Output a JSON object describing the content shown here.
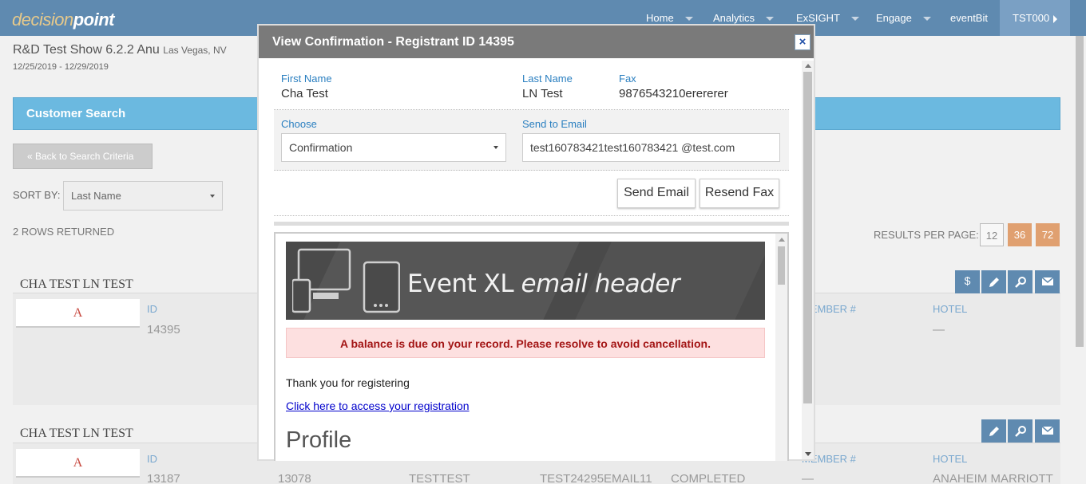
{
  "brand": {
    "logo_part1": "decision",
    "logo_part2": "point"
  },
  "nav": {
    "items": [
      "Home",
      "Analytics",
      "ExSIGHT",
      "Engage",
      "eventBit"
    ],
    "user": "TST000"
  },
  "show": {
    "title": "R&D Test Show 6.2.2 Anu",
    "location": "Las Vegas, NV",
    "dates": "12/25/2019 - 12/29/2019"
  },
  "search": {
    "header": "Customer Search",
    "back_label": "« Back to Search Criteria",
    "sort_label": "SORT BY:",
    "sort_value": "Last Name",
    "rows_returned": "2 ROWS RETURNED",
    "results_per_page_label": "RESULTS PER PAGE:",
    "results_per_page_options": [
      "12",
      "36",
      "72"
    ]
  },
  "records": [
    {
      "name": "CHA TEST LN TEST",
      "avatar": "A",
      "id_label": "ID",
      "id": "14395",
      "member_label": "MEMBER #",
      "hotel_label": "HOTEL",
      "hotel": "—"
    },
    {
      "name": "CHA TEST LN TEST",
      "avatar": "A",
      "id_label": "ID",
      "id": "13187",
      "badge": "13078",
      "company": "TESTTEST",
      "email": "TEST24295EMAIL11",
      "status": "COMPLETED",
      "member_label": "MEMBER #",
      "member": "—",
      "hotel_label": "HOTEL",
      "hotel": "ANAHEIM MARRIOTT"
    }
  ],
  "actions": {
    "payment_symbol": "$"
  },
  "modal": {
    "title": "View Confirmation - Registrant ID 14395",
    "close": "×",
    "first_name_label": "First Name",
    "first_name": "Cha Test",
    "last_name_label": "Last Name",
    "last_name": "LN Test",
    "fax_label": "Fax",
    "fax": "9876543210erererer",
    "choose_label": "Choose",
    "choose_value": "Confirmation",
    "send_to_email_label": "Send to Email",
    "send_to_email": "test160783421test160783421 @test.com",
    "send_email_button": "Send Email",
    "resend_fax_button": "Resend Fax"
  },
  "email_preview": {
    "header_text_plain": "Event XL ",
    "header_text_italic": "email header",
    "balance_notice": "A balance is due on your record. Please resolve to avoid cancellation.",
    "thanks": "Thank you for registering",
    "registration_link": "Click here to access your registration",
    "profile_heading": "Profile"
  },
  "colors": {
    "nav_bg": "#5f8ab0",
    "search_header_bg": "#6bb9e0",
    "modal_header_bg": "#7a7a7a",
    "accent_orange": "#e0a070",
    "balance_bg": "#fde0e0",
    "balance_text": "#a31515"
  }
}
